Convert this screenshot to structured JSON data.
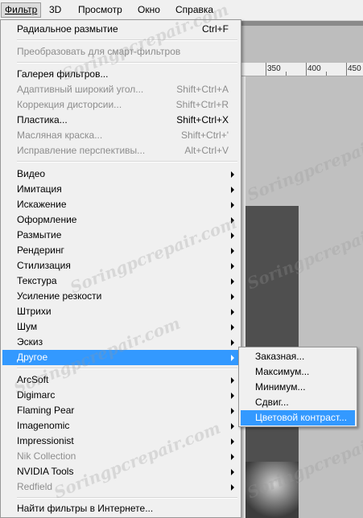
{
  "menubar": [
    {
      "label": "Фильтр",
      "active": true
    },
    {
      "label": "3D",
      "active": false
    },
    {
      "label": "Просмотр",
      "active": false
    },
    {
      "label": "Окно",
      "active": false
    },
    {
      "label": "Справка",
      "active": false
    }
  ],
  "ruler": {
    "labels": [
      "350",
      "400",
      "450"
    ]
  },
  "filter_menu": {
    "items": [
      {
        "label": "Радиальное размытие",
        "shortcut": "Ctrl+F",
        "disabled": false
      },
      {
        "label": "Преобразовать для смарт-фильтров",
        "shortcut": "",
        "disabled": true
      },
      {
        "label": "Галерея фильтров...",
        "shortcut": "",
        "disabled": false
      },
      {
        "label": "Адаптивный широкий угол...",
        "shortcut": "Shift+Ctrl+A",
        "disabled": true
      },
      {
        "label": "Коррекция дисторсии...",
        "shortcut": "Shift+Ctrl+R",
        "disabled": true
      },
      {
        "label": "Пластика...",
        "shortcut": "Shift+Ctrl+X",
        "disabled": false
      },
      {
        "label": "Масляная краска...",
        "shortcut": "Shift+Ctrl+'",
        "disabled": true
      },
      {
        "label": "Исправление перспективы...",
        "shortcut": "Alt+Ctrl+V",
        "disabled": true
      },
      {
        "label": "Видео",
        "submenu": true
      },
      {
        "label": "Имитация",
        "submenu": true
      },
      {
        "label": "Искажение",
        "submenu": true
      },
      {
        "label": "Оформление",
        "submenu": true
      },
      {
        "label": "Размытие",
        "submenu": true
      },
      {
        "label": "Рендеринг",
        "submenu": true
      },
      {
        "label": "Стилизация",
        "submenu": true
      },
      {
        "label": "Текстура",
        "submenu": true
      },
      {
        "label": "Усиление резкости",
        "submenu": true
      },
      {
        "label": "Штрихи",
        "submenu": true
      },
      {
        "label": "Шум",
        "submenu": true
      },
      {
        "label": "Эскиз",
        "submenu": true
      },
      {
        "label": "Другое",
        "submenu": true,
        "highlighted": true
      },
      {
        "label": "ArcSoft",
        "submenu": true
      },
      {
        "label": "Digimarc",
        "submenu": true
      },
      {
        "label": "Flaming Pear",
        "submenu": true
      },
      {
        "label": "Imagenomic",
        "submenu": true
      },
      {
        "label": "Impressionist",
        "submenu": true
      },
      {
        "label": "Nik Collection",
        "submenu": true,
        "disabled": true
      },
      {
        "label": "NVIDIA Tools",
        "submenu": true
      },
      {
        "label": "Redfield",
        "submenu": true,
        "disabled": true
      },
      {
        "label": "Найти фильтры в Интернете...",
        "shortcut": ""
      }
    ]
  },
  "other_submenu": {
    "items": [
      {
        "label": "Заказная..."
      },
      {
        "label": "Максимум..."
      },
      {
        "label": "Минимум..."
      },
      {
        "label": "Сдвиг..."
      },
      {
        "label": "Цветовой контраст...",
        "highlighted": true
      }
    ]
  },
  "watermark": "Soringpcrepair.com",
  "colors": {
    "menu_bg": "#f0f0f0",
    "highlight": "#3399ff",
    "disabled_text": "#8d8d8d"
  }
}
